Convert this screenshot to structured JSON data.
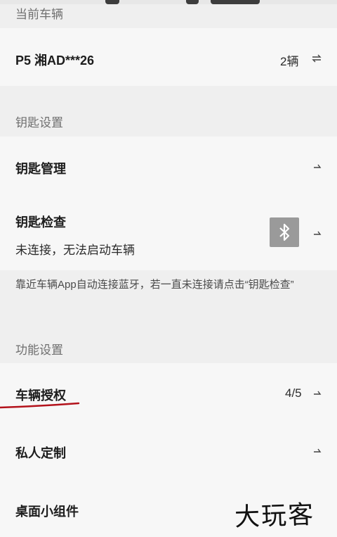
{
  "current_vehicle": {
    "section_title": "当前车辆",
    "vehicle_label": "P5 湘AD***26",
    "count_label": "2辆",
    "switch_icon": "swap-arrows-icon"
  },
  "key_settings": {
    "section_title": "钥匙设置",
    "key_management_label": "钥匙管理",
    "key_check_label": "钥匙检查",
    "key_check_status": "未连接，无法启动车辆",
    "bluetooth_icon": "bluetooth-icon",
    "hint_text": "靠近车辆App自动连接蓝牙，若一直未连接请点击“钥匙检查”"
  },
  "function_settings": {
    "section_title": "功能设置",
    "vehicle_authorization_label": "车辆授权",
    "vehicle_authorization_count": "4/5",
    "personal_customization_label": "私人定制",
    "desktop_widget_label": "桌面小组件"
  },
  "watermark_text": "大玩客",
  "colors": {
    "page_background": "#efefef",
    "card_background": "#f7f7f7",
    "section_title": "#6f6f6f",
    "bluetooth_badge": "#9a9a9a",
    "annotation_red": "#b3121b"
  }
}
